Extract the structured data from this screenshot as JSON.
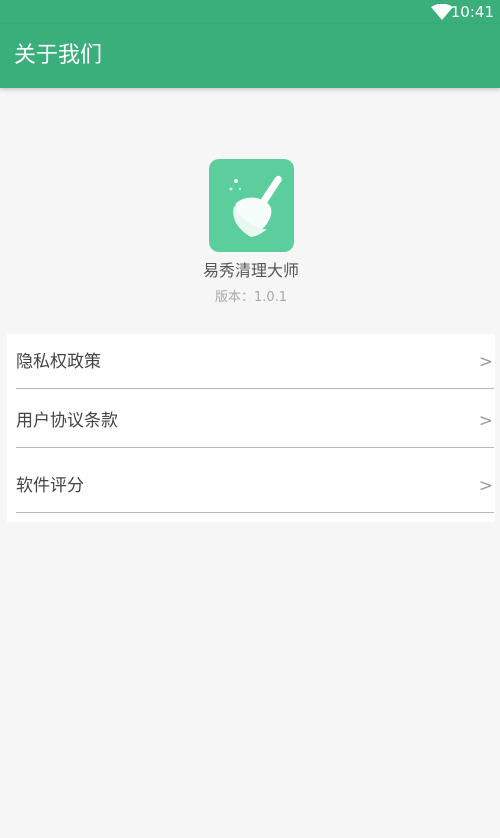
{
  "status_bar": {
    "time": "10:41",
    "wifi_icon": "wifi-icon"
  },
  "app_bar": {
    "title": "关于我们"
  },
  "about": {
    "app_icon": "broom-icon",
    "app_name": "易秀清理大师",
    "version_label": "版本：",
    "version": "1.0.1"
  },
  "menu": {
    "items": [
      {
        "label": "隐私权政策",
        "chevron": ">"
      },
      {
        "label": "用户协议条款",
        "chevron": ">"
      },
      {
        "label": "软件评分",
        "chevron": ">"
      }
    ]
  },
  "colors": {
    "primary": "#3aae7b",
    "icon_bg": "#5cce9d",
    "page_bg": "#f6f6f6",
    "card_bg": "#ffffff"
  }
}
